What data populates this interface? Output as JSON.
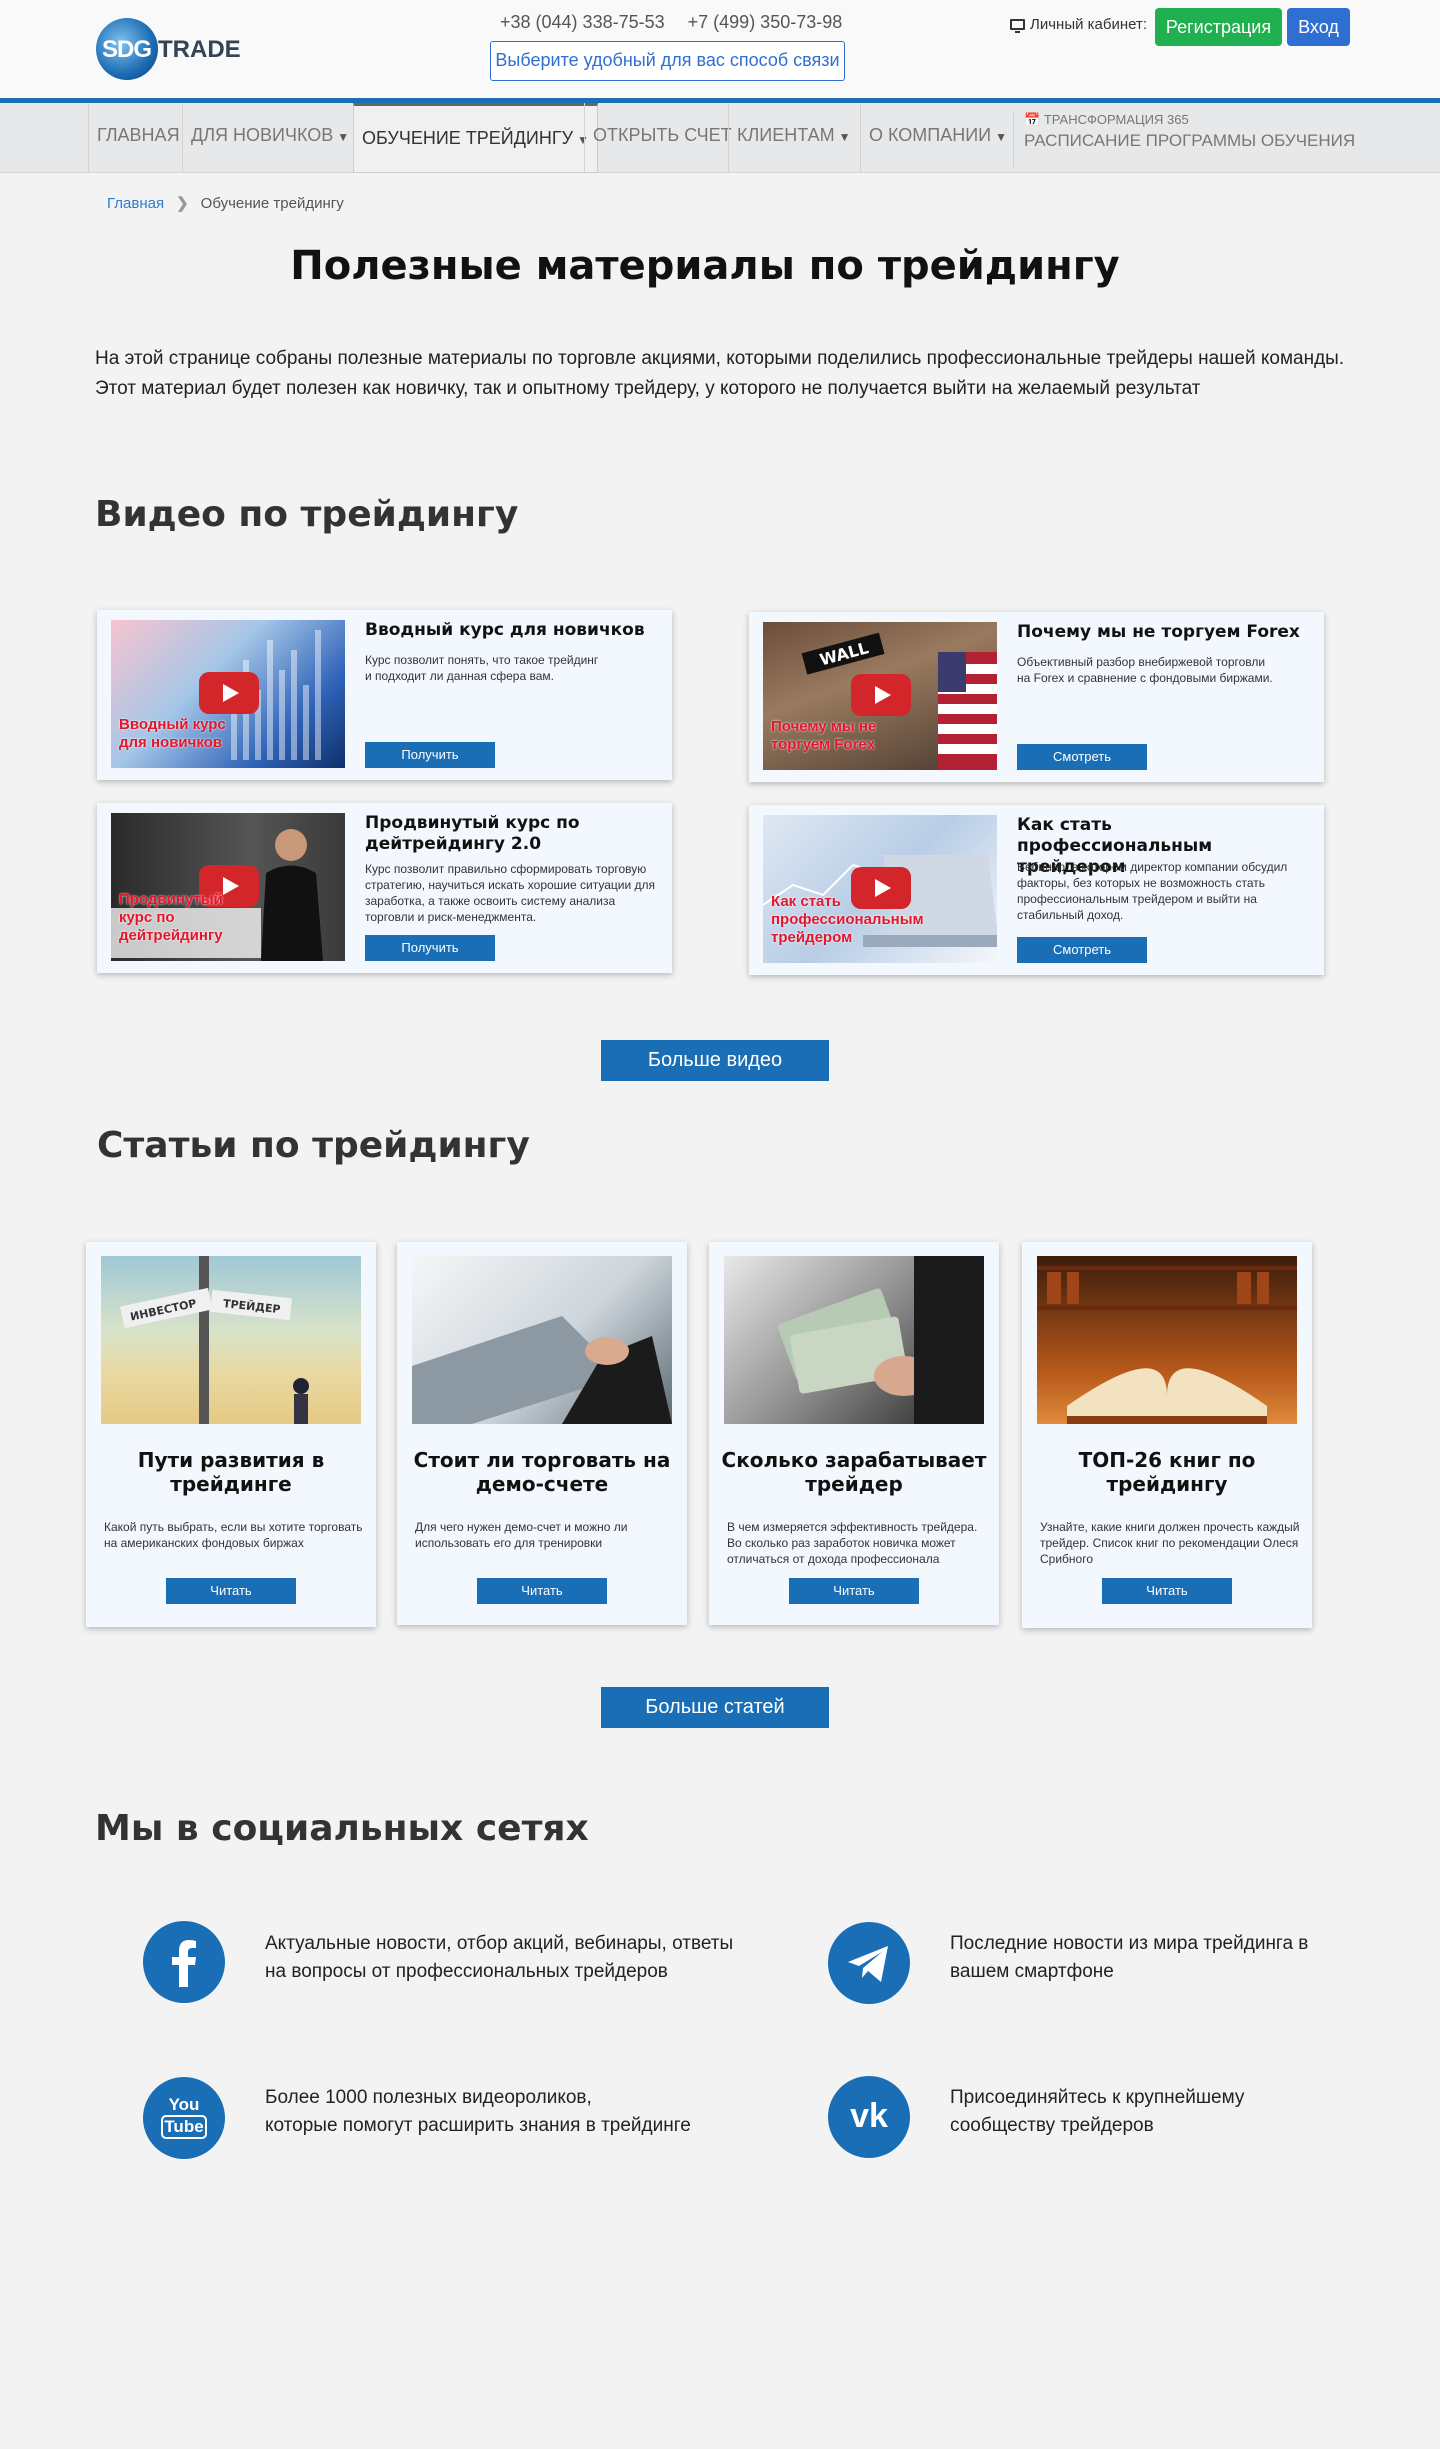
{
  "header": {
    "logo_text_1": "SDG",
    "logo_text_2": "TRADE",
    "phone1": "+38 (044) 338-75-53",
    "phone2": "+7 (499) 350-73-98",
    "contact_btn": "Выберите удобный для вас способ связи",
    "cabinet_label": "Личный кабинет:",
    "register": "Регистрация",
    "login": "Вход"
  },
  "nav": {
    "items": [
      "ГЛАВНАЯ",
      "ДЛЯ НОВИЧКОВ",
      "ОБУЧЕНИЕ ТРЕЙДИНГУ",
      "ОТКРЫТЬ СЧЕТ",
      "КЛИЕНТАМ",
      "О КОМПАНИИ"
    ],
    "sched_small": "ТРАНСФОРМАЦИЯ 365",
    "sched_big": "РАСПИСАНИЕ ПРОГРАММЫ ОБУЧЕНИЯ"
  },
  "breadcrumb": {
    "home": "Главная",
    "current": "Обучение трейдингу"
  },
  "page": {
    "title": "Полезные материалы по трейдингу",
    "intro_1": "На этой странице собраны полезные материалы по торговле акциями, которыми поделились профессиональные трейдеры нашей команды.",
    "intro_2": "Этот материал будет полезен как новичку, так и опытному трейдеру, у которого не получается выйти на желаемый результат"
  },
  "videos": {
    "heading": "Видео по трейдингу",
    "more": "Больше видео",
    "items": [
      {
        "title": "Вводный курс для новичков",
        "desc": "Курс позволит понять, что такое трейдинг и подходит ли данная сфера вам.",
        "btn": "Получить",
        "cap": "Вводный курс для новичков"
      },
      {
        "title": "Почему мы не торгуем Forex",
        "desc": "Объективный разбор внебиржевой торговли на Forex и сравнение с фондовыми биржами.",
        "btn": "Смотреть",
        "cap": "Почему мы не торгуем Forex"
      },
      {
        "title": "Продвинутый курс по дейтрейдингу 2.0",
        "desc": "Курс позволит правильно сформировать торговую стратегию, научиться искать хорошие ситуации для заработка, а также освоить систему анализа торговли и риск-менеджмента.",
        "btn": "Получить",
        "cap": "Продвинутый курс по дейтрейдингу"
      },
      {
        "title": "Как стать профессиональным трейдером",
        "desc": "Вебинар, в котором директор компании обсудил факторы, без которых не возможность стать профессиональным трейдером и выйти на стабильный доход.",
        "btn": "Смотреть",
        "cap": "Как стать профессиональным трейдером"
      }
    ]
  },
  "articles": {
    "heading": "Статьи по трейдингу",
    "more": "Больше статей",
    "items": [
      {
        "title": "Пути развития в трейдинге",
        "desc": "Какой путь выбрать, если вы хотите торговать на американских фондовых биржах",
        "btn": "Читать",
        "sign1": "ИНВЕСТОР",
        "sign2": "ТРЕЙДЕР"
      },
      {
        "title": "Стоит ли торговать на демо-счете",
        "desc": "Для чего нужен демо-счет и можно ли использовать его для тренировки",
        "btn": "Читать"
      },
      {
        "title": "Сколько зарабатывает трейдер",
        "desc": "В чем измеряется эффективность трейдера. Во сколько раз заработок новичка может отличаться от дохода профессионала",
        "btn": "Читать"
      },
      {
        "title": "ТОП-26 книг по трейдингу",
        "desc": "Узнайте, какие книги должен прочесть каждый трейдер. Список книг по рекомендации Олеся Срибного",
        "btn": "Читать"
      }
    ]
  },
  "social": {
    "heading": "Мы в социальных сетях",
    "items": [
      {
        "icon": "facebook-icon",
        "l1": "Актуальные новости, отбор акций, вебинары, ответы",
        "l2": "на вопросы от профессиональных трейдеров"
      },
      {
        "icon": "telegram-icon",
        "l1": "Последние новости из мира трейдинга в",
        "l2": "вашем смартфоне"
      },
      {
        "icon": "youtube-icon",
        "l1": "Более 1000 полезных видеороликов,",
        "l2": "которые помогут расширить знания в трейдинге",
        "glyph1": "You",
        "glyph2": "Tube"
      },
      {
        "icon": "vk-icon",
        "l1": "Присоединяйтесь к крупнейшему",
        "l2": "сообществу трейдеров",
        "glyph": "vk"
      }
    ]
  },
  "colors": {
    "accent": "#1a6eb5",
    "register": "#20b04f",
    "login": "#2f6fd1",
    "caption_red": "#e4162b"
  }
}
